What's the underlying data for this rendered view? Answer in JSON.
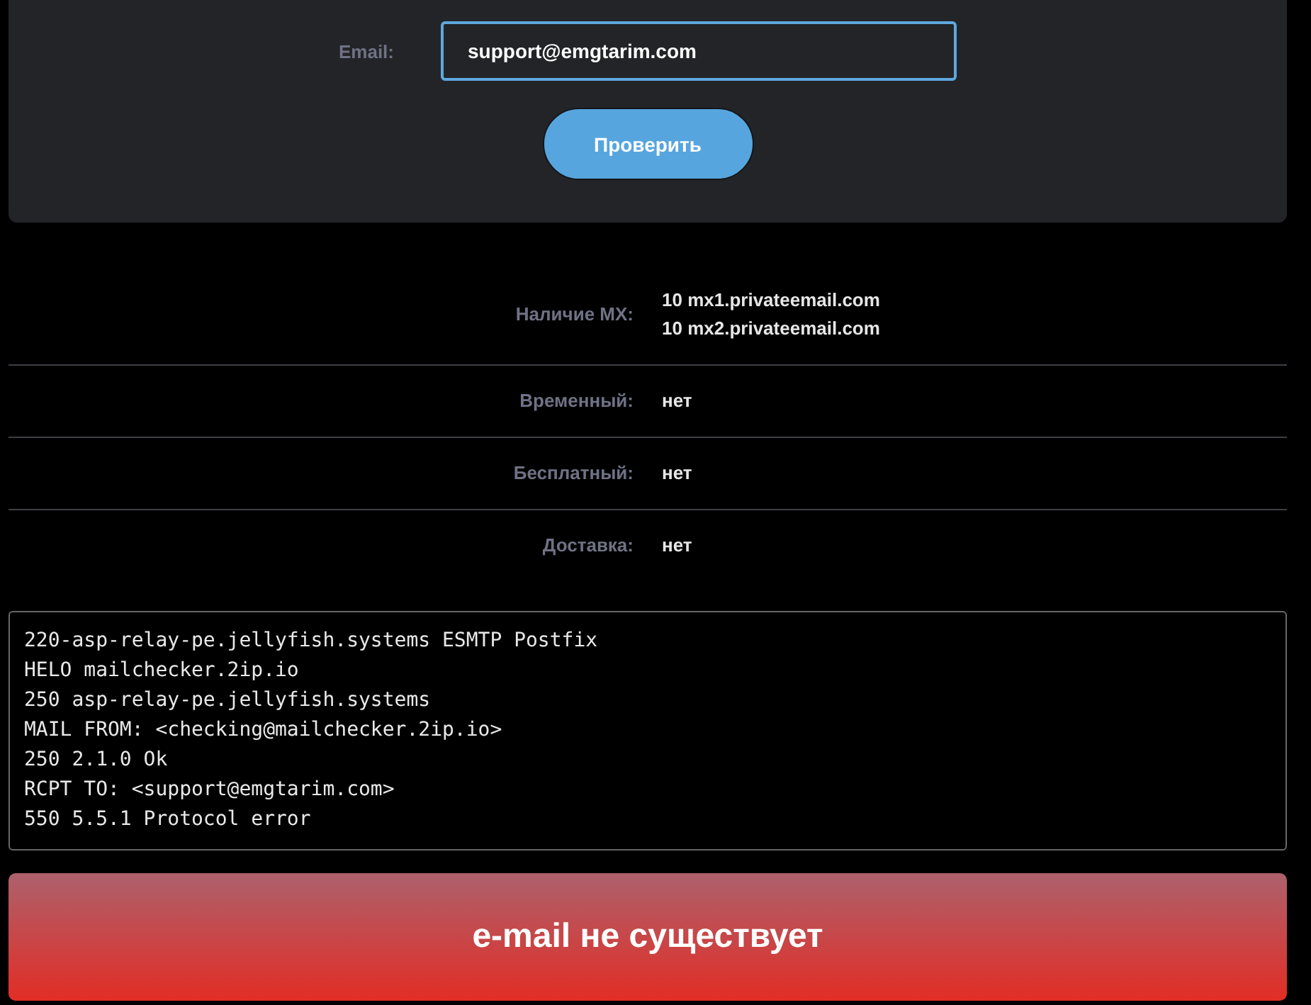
{
  "form": {
    "label": "Email:",
    "value": "support@emgtarim.com",
    "submit": "Проверить"
  },
  "results": [
    {
      "label": "Наличие MX:",
      "values": [
        "10 mx1.privateemail.com",
        "10 mx2.privateemail.com"
      ]
    },
    {
      "label": "Временный:",
      "values": [
        "нет"
      ]
    },
    {
      "label": "Бесплатный:",
      "values": [
        "нет"
      ]
    },
    {
      "label": "Доставка:",
      "values": [
        "нет"
      ]
    }
  ],
  "smtp_log": [
    "220-asp-relay-pe.jellyfish.systems ESMTP Postfix",
    "HELO mailchecker.2ip.io",
    "250 asp-relay-pe.jellyfish.systems",
    "MAIL FROM: <checking@mailchecker.2ip.io>",
    "250 2.1.0 Ok",
    "RCPT TO: <support@emgtarim.com>",
    "550 5.5.1 Protocol error"
  ],
  "verdict": {
    "text": "e-mail не существует",
    "exists": false
  }
}
